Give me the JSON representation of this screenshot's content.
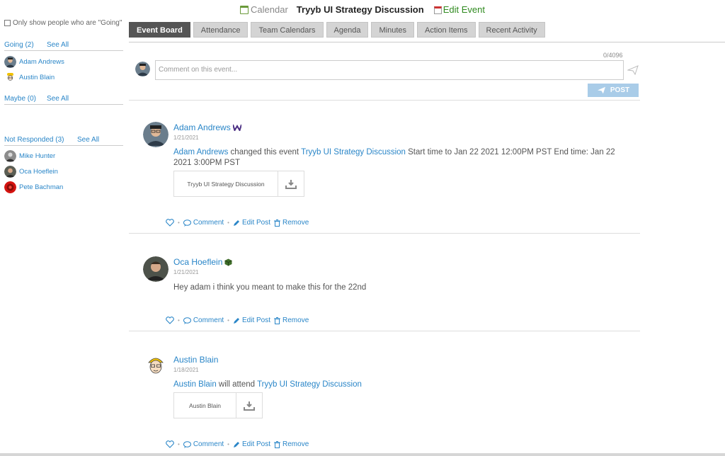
{
  "header": {
    "calendar_label": "Calendar",
    "event_title": "Tryyb UI Strategy Discussion",
    "edit_label": "Edit Event"
  },
  "sidebar": {
    "only_show_label": "Only show people who are \"Going\"",
    "going": {
      "label": "Going (2)",
      "see_all": "See All",
      "people": [
        "Adam Andrews",
        "Austin Blain"
      ]
    },
    "maybe": {
      "label": "Maybe (0)",
      "see_all": "See All"
    },
    "not_responded": {
      "label": "Not Responded (3)",
      "see_all": "See All",
      "people": [
        "Mike Hunter",
        "Oca Hoeflein",
        "Pete Bachman"
      ]
    }
  },
  "tabs": [
    "Event Board",
    "Attendance",
    "Team Calendars",
    "Agenda",
    "Minutes",
    "Action Items",
    "Recent Activity"
  ],
  "composer": {
    "counter": "0/4096",
    "placeholder": "Comment on this event...",
    "post_label": "POST"
  },
  "actions": {
    "comment": "Comment",
    "edit": "Edit Post",
    "remove": "Remove"
  },
  "posts": [
    {
      "author": "Adam Andrews",
      "date": "1/21/2021",
      "actor": "Adam Andrews",
      "verb": " changed this event ",
      "event_link": "Tryyb UI Strategy Discussion",
      "detail": "  Start time to Jan 22 2021 12:00PM PST End time: Jan 22 2021 3:00PM PST",
      "attachment": "Tryyb UI Strategy Discussion"
    },
    {
      "author": "Oca Hoeflein",
      "date": "1/21/2021",
      "text": "Hey adam i think you meant to make this for the 22nd"
    },
    {
      "author": "Austin Blain",
      "date": "1/18/2021",
      "actor": "Austin Blain",
      "verb": " will attend ",
      "event_link": "Tryyb UI Strategy Discussion",
      "attachment": "Austin Blain"
    }
  ],
  "colors": {
    "link": "#2a86c8",
    "edit_green": "#2f8a1f",
    "active_tab": "#555555",
    "post_button": "#a9cce8"
  }
}
